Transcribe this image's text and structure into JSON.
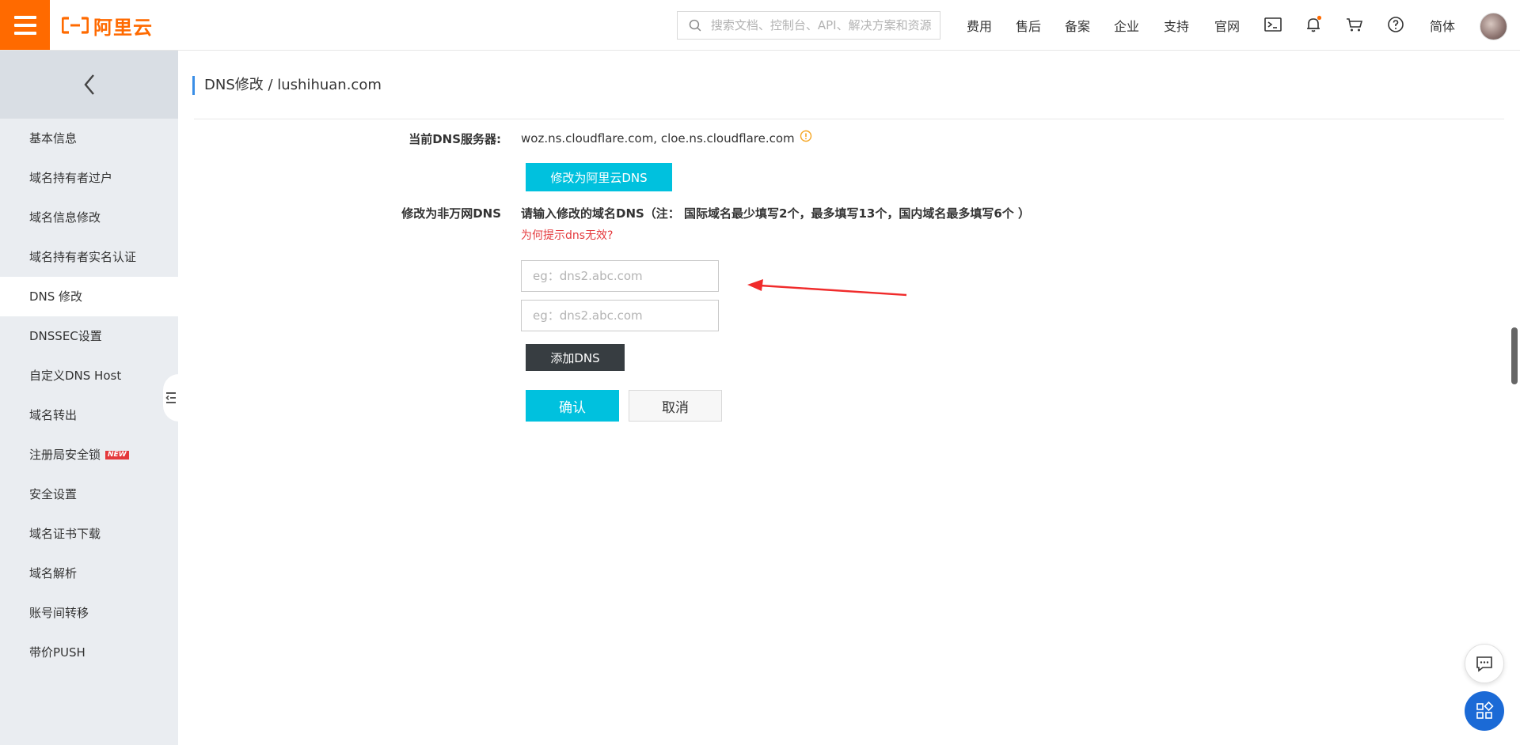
{
  "header": {
    "logo_text": "阿里云",
    "search_placeholder": "搜索文档、控制台、API、解决方案和资源",
    "nav": [
      "费用",
      "售后",
      "备案",
      "企业",
      "支持",
      "官网"
    ],
    "lang": "简体",
    "icons": [
      "terminal-icon",
      "bell-icon",
      "cart-icon",
      "help-icon"
    ],
    "brand_color": "#ff6a00",
    "notification_dot_color": "#ff6a00"
  },
  "sidebar": {
    "back_icon": "chevron-left-icon",
    "items": [
      {
        "label": "基本信息"
      },
      {
        "label": "域名持有者过户"
      },
      {
        "label": "域名信息修改"
      },
      {
        "label": "域名持有者实名认证"
      },
      {
        "label": "DNS 修改",
        "active": true
      },
      {
        "label": "DNSSEC设置"
      },
      {
        "label": "自定义DNS Host"
      },
      {
        "label": "域名转出"
      },
      {
        "label": "注册局安全锁",
        "badge": "NEW"
      },
      {
        "label": "安全设置"
      },
      {
        "label": "域名证书下载"
      },
      {
        "label": "域名解析"
      },
      {
        "label": "账号间转移"
      },
      {
        "label": "带价PUSH"
      }
    ]
  },
  "main": {
    "title": "DNS修改 / lushihuan.com",
    "current_dns_label": "当前DNS服务器:",
    "current_dns_value": "woz.ns.cloudflare.com, cloe.ns.cloudflare.com",
    "switch_button": "修改为阿里云DNS",
    "custom_dns_label": "修改为非万网DNS",
    "custom_dns_hint": "请输入修改的域名DNS（注： 国际域名最少填写2个，最多填写13个，国内域名最多填写6个 ）",
    "why_link": "为何提示dns无效?",
    "inputs": [
      {
        "value": "",
        "placeholder": "eg：dns2.abc.com"
      },
      {
        "value": "",
        "placeholder": "eg：dns2.abc.com"
      }
    ],
    "add_button": "添加DNS",
    "confirm_button": "确认",
    "cancel_button": "取消",
    "accent_color": "#00c1de",
    "link_color": "#e4393c",
    "annotation_color": "#f02b2b"
  },
  "floating": {
    "chat_icon": "chat-icon",
    "apps_icon": "apps-icon"
  }
}
